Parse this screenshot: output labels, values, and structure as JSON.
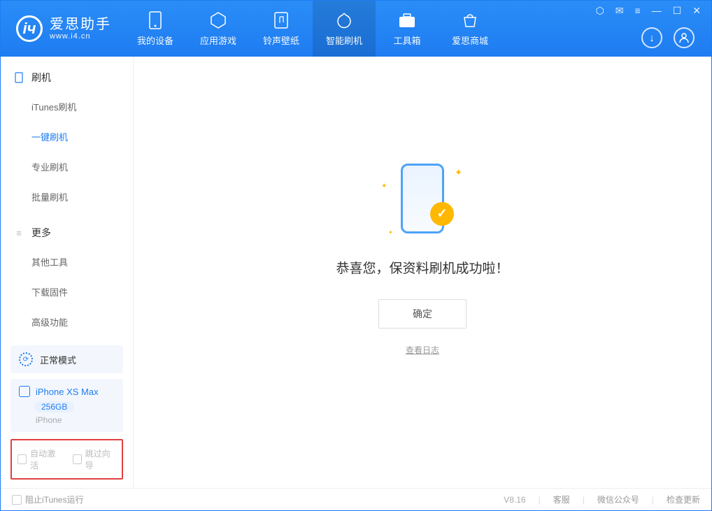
{
  "brand": {
    "name": "爱思助手",
    "url": "www.i4.cn"
  },
  "tabs": [
    {
      "label": "我的设备",
      "icon": "device"
    },
    {
      "label": "应用游戏",
      "icon": "apps"
    },
    {
      "label": "铃声壁纸",
      "icon": "ringtone"
    },
    {
      "label": "智能刷机",
      "icon": "flash",
      "active": true
    },
    {
      "label": "工具箱",
      "icon": "toolbox"
    },
    {
      "label": "爱思商城",
      "icon": "store"
    }
  ],
  "sidebar": {
    "section1": {
      "title": "刷机",
      "items": [
        "iTunes刷机",
        "一键刷机",
        "专业刷机",
        "批量刷机"
      ],
      "activeIndex": 1
    },
    "section2": {
      "title": "更多",
      "items": [
        "其他工具",
        "下载固件",
        "高级功能"
      ]
    },
    "mode": "正常模式",
    "device": {
      "name": "iPhone XS Max",
      "storage": "256GB",
      "type": "iPhone"
    },
    "checkboxes": {
      "auto_activate": "自动激活",
      "skip_guide": "跳过向导"
    }
  },
  "main": {
    "success_text": "恭喜您，保资料刷机成功啦！",
    "ok_button": "确定",
    "log_link": "查看日志"
  },
  "footer": {
    "block_itunes": "阻止iTunes运行",
    "version": "V8.16",
    "support": "客服",
    "wechat": "微信公众号",
    "check_update": "检查更新"
  }
}
